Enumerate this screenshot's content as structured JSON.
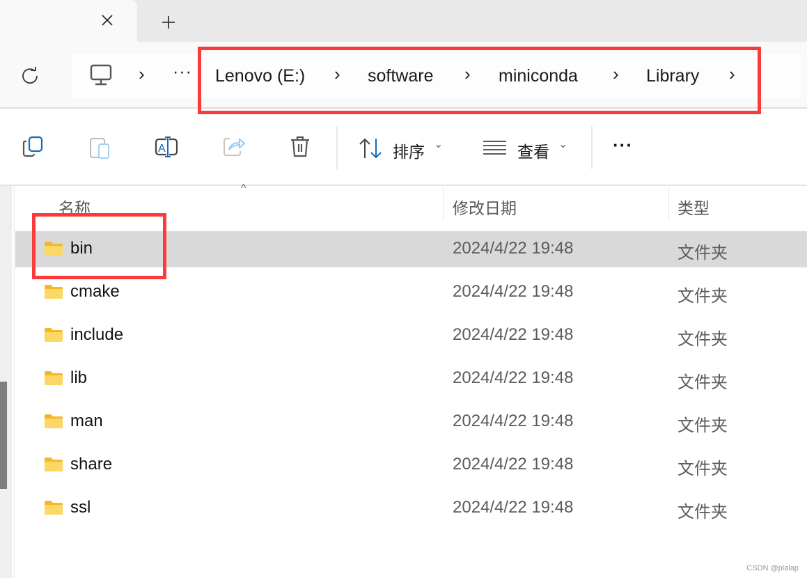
{
  "tabbar": {
    "close_icon": "close-icon",
    "new_tab_icon": "plus-icon"
  },
  "nav": {
    "refresh_icon": "refresh-icon",
    "breadcrumb": [
      "Lenovo (E:)",
      "software",
      "miniconda",
      "Library"
    ],
    "overflow": "···"
  },
  "toolbar": {
    "sort_label": "排序",
    "view_label": "查看",
    "more": "···"
  },
  "columns": {
    "name": "名称",
    "date": "修改日期",
    "type": "类型"
  },
  "files": [
    {
      "name": "bin",
      "date": "2024/4/22 19:48",
      "type": "文件夹",
      "selected": true
    },
    {
      "name": "cmake",
      "date": "2024/4/22 19:48",
      "type": "文件夹"
    },
    {
      "name": "include",
      "date": "2024/4/22 19:48",
      "type": "文件夹"
    },
    {
      "name": "lib",
      "date": "2024/4/22 19:48",
      "type": "文件夹"
    },
    {
      "name": "man",
      "date": "2024/4/22 19:48",
      "type": "文件夹"
    },
    {
      "name": "share",
      "date": "2024/4/22 19:48",
      "type": "文件夹"
    },
    {
      "name": "ssl",
      "date": "2024/4/22 19:48",
      "type": "文件夹"
    }
  ],
  "colors": {
    "annotation": "#fb3a3a",
    "accent": "#0f6cbd",
    "selected_row": "#d9d9d9",
    "folder": "#f8cd4d"
  },
  "watermark": "CSDN @plalap"
}
